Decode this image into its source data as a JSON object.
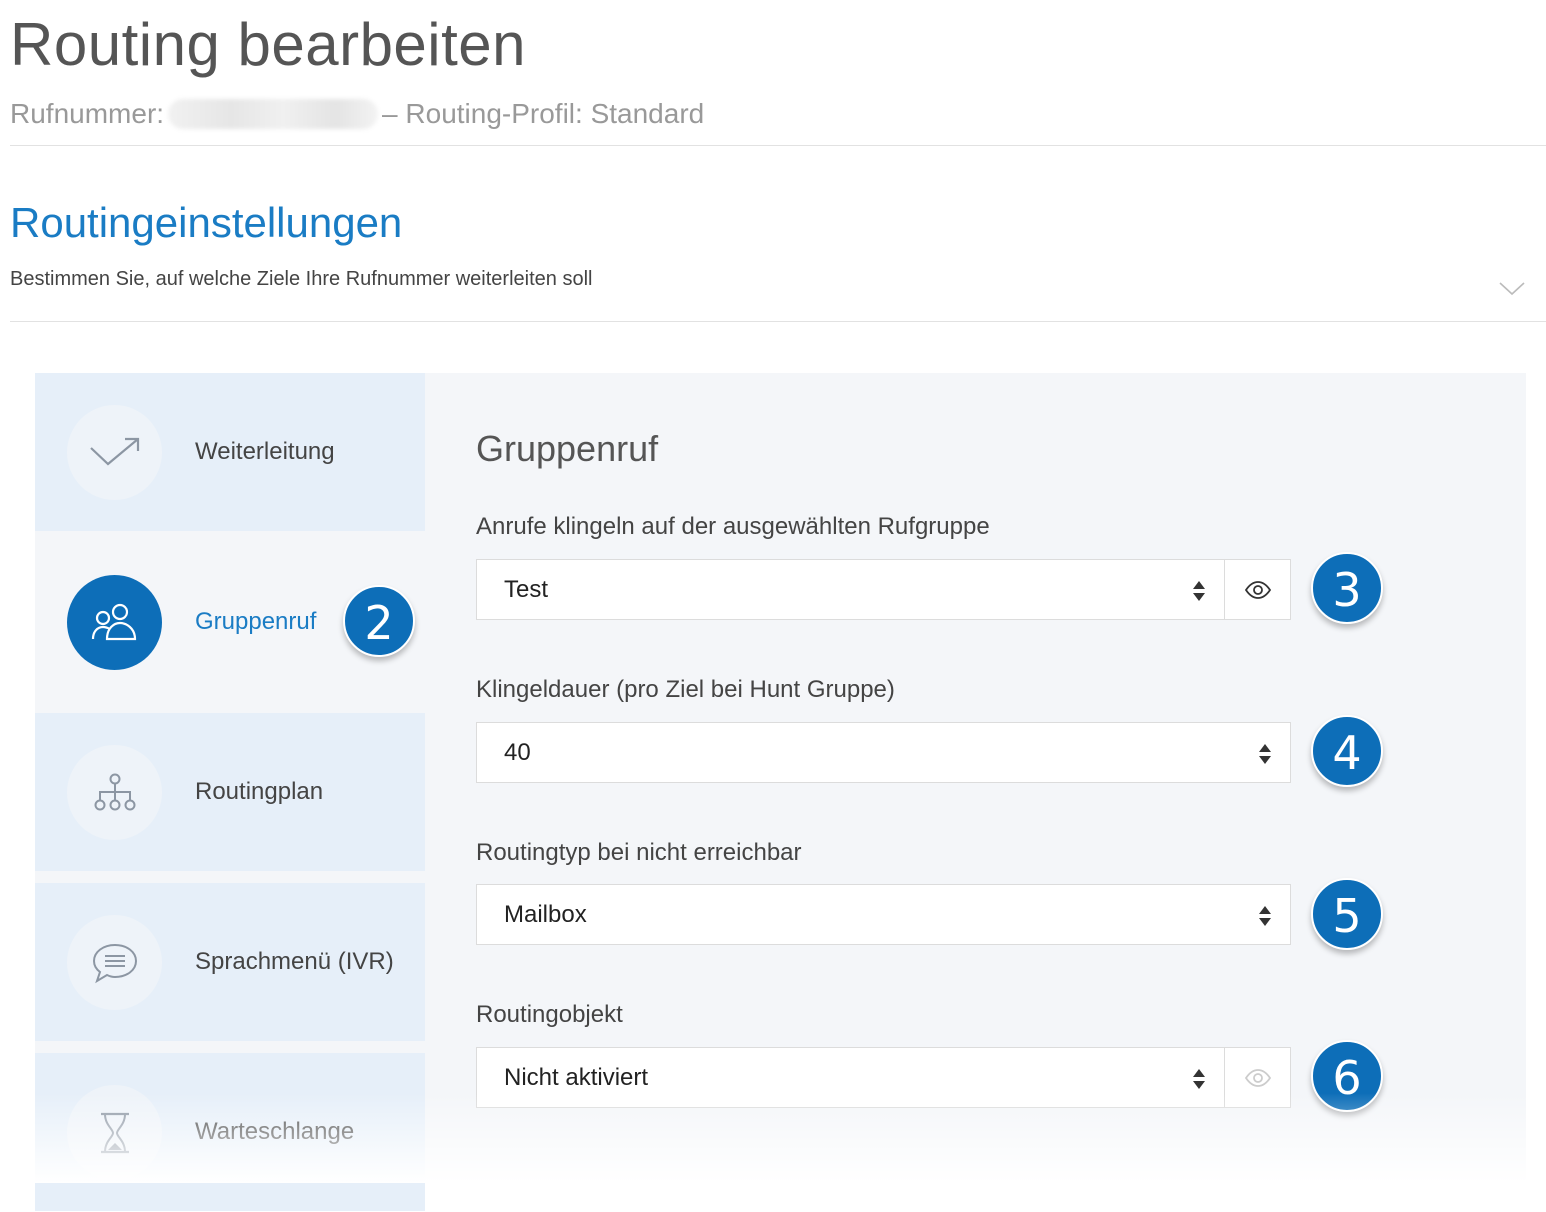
{
  "header": {
    "title": "Routing bearbeiten",
    "phone_label": "Rufnummer:",
    "profile_text": "– Routing-Profil: Standard"
  },
  "section": {
    "title": "Routingeinstellungen",
    "description": "Bestimmen Sie, auf welche Ziele Ihre Rufnummer weiterleiten soll"
  },
  "nav": {
    "items": [
      {
        "label": "Weiterleitung",
        "icon": "arrow-forward-icon"
      },
      {
        "label": "Gruppenruf",
        "icon": "group-icon",
        "active": true
      },
      {
        "label": "Routingplan",
        "icon": "org-chart-icon"
      },
      {
        "label": "Sprachmenü (IVR)",
        "icon": "speech-bubble-icon"
      },
      {
        "label": "Warteschlange",
        "icon": "hourglass-icon"
      }
    ]
  },
  "form": {
    "title": "Gruppenruf",
    "ring_group": {
      "label": "Anrufe klingeln auf der ausgewählten Rufgruppe",
      "value": "Test"
    },
    "ring_duration": {
      "label": "Klingeldauer (pro Ziel bei Hunt Gruppe)",
      "value": "40"
    },
    "unreachable_type": {
      "label": "Routingtyp bei nicht erreichbar",
      "value": "Mailbox"
    },
    "routing_object": {
      "label": "Routingobjekt",
      "value": "Nicht aktiviert"
    }
  },
  "badges": [
    "2",
    "3",
    "4",
    "5",
    "6"
  ],
  "colors": {
    "accent": "#0d6eb8",
    "link": "#1a7cc4",
    "panel": "#f4f6f9",
    "nav_bg": "#e6eff9"
  }
}
